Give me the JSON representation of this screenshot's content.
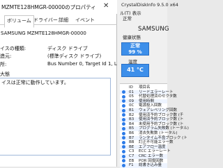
{
  "props": {
    "title": "MZMTE128HMGR-00000のプロパティ",
    "close": "✕",
    "tabs": [
      "ボリューム",
      "ドライバー",
      "詳細",
      "イベント"
    ],
    "device_name": "SAMSUNG MZMTE128HMGR-00000",
    "fields": [
      {
        "label": "イスの種類:",
        "value": "ディスク ドライブ"
      },
      {
        "label": "造元:",
        "value": "(標準ディスク ドライブ)"
      },
      {
        "label": "所:",
        "value": "Bus Number 0, Target Id 1, LUN 0"
      }
    ],
    "status_label": "大態",
    "status_text": "イスは正常に動作しています。"
  },
  "cdi": {
    "title": "CrystalDiskInfo 9.5.0 x64",
    "menu": "ル(T)  表示",
    "drive": "正常",
    "model": "SAMSUNG",
    "side_labels": [
      "健康状態",
      "温度"
    ],
    "health": {
      "state": "正常",
      "percent": "99 %"
    },
    "temperature": "41 °C",
    "smart_rows": [
      {
        "id": "ID",
        "name": "項目名"
      },
      {
        "id": "01",
        "name": "リードエラーレート"
      },
      {
        "id": "05",
        "name": "代替処理済のセクタ数"
      },
      {
        "id": "09",
        "name": "使用時間"
      },
      {
        "id": "0C",
        "name": "電源投入回数"
      },
      {
        "id": "B1",
        "name": "ウェアレベリング回数"
      },
      {
        "id": "B2",
        "name": "使用済予約ブロック数 (チ"
      },
      {
        "id": "B3",
        "name": "使用済予約ブロック数 (ト"
      },
      {
        "id": "B4",
        "name": "未使用予約ブロック数 (ト"
      },
      {
        "id": "B5",
        "name": "プログラム失敗数 (トータル)"
      },
      {
        "id": "B6",
        "name": "消去失敗数 (トータル)"
      },
      {
        "id": "B7",
        "name": "ランタイム不良ブロック (ト"
      },
      {
        "id": "BB",
        "name": "訂正不可能エラー数"
      },
      {
        "id": "BE",
        "name": "エアフロー温度"
      },
      {
        "id": "C3",
        "name": "ECC エラーレート"
      },
      {
        "id": "C7",
        "name": "CRC エラー数"
      },
      {
        "id": "EB",
        "name": "POR 回復回数"
      },
      {
        "id": "F1",
        "name": "総書き込み量"
      }
    ],
    "colors": {
      "accent": "#3d8fea",
      "dot": "#2d7be8"
    }
  }
}
